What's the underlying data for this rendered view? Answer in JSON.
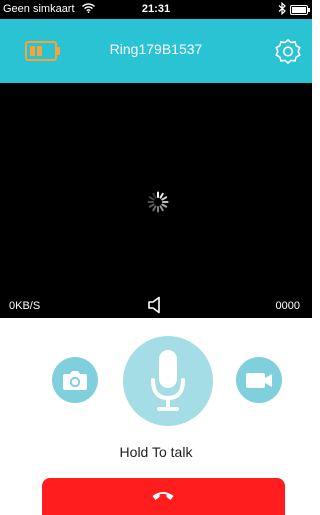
{
  "status_bar": {
    "carrier": "Geen simkaart",
    "time": "21:31",
    "wifi_icon": "wifi-icon",
    "bluetooth_icon": "bluetooth-icon",
    "battery_icon": "battery-full-icon"
  },
  "header": {
    "title": "Ring179B1537",
    "background": "#29c3d4",
    "battery_icon": "battery-low-icon",
    "settings_icon": "gear-icon"
  },
  "video": {
    "speed": "0KB/S",
    "counter": "0000",
    "loading_icon": "spinner-icon",
    "speaker_icon": "speaker-icon"
  },
  "controls": {
    "snapshot_icon": "camera-icon",
    "talk_icon": "microphone-icon",
    "record_icon": "video-camera-icon",
    "hold_to_talk_label": "Hold To talk",
    "hangup_icon": "phone-hangup-icon",
    "hangup_color": "#ff1d1d"
  }
}
